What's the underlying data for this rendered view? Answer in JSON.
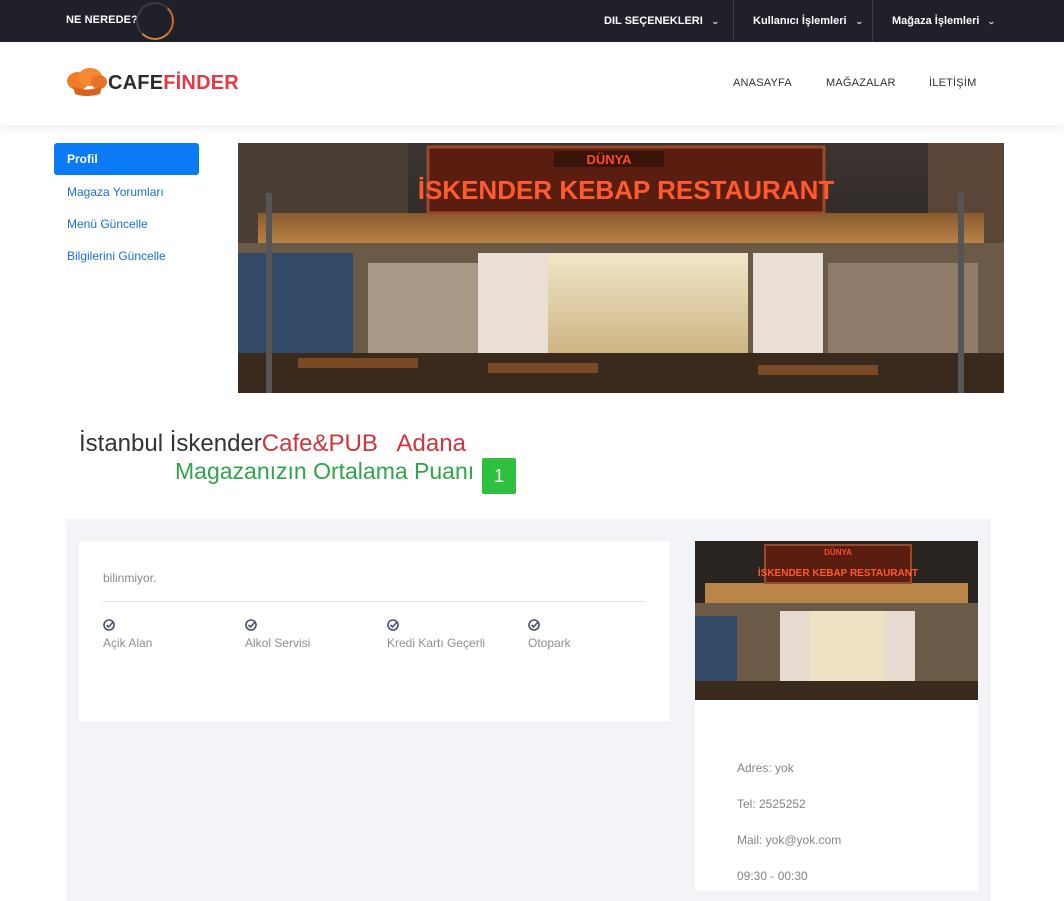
{
  "topbar": {
    "brand": "NE NEREDE?",
    "menus": [
      {
        "label": "DIL SEÇENEKLERI"
      },
      {
        "label": "Kullanıcı İşlemleri"
      },
      {
        "label": "Mağaza İşlemleri"
      }
    ],
    "chevron": "⌄"
  },
  "header": {
    "logo": {
      "part1": "CAFE",
      "part2": "FİNDER",
      "icon": "chef-hat-icon"
    },
    "nav": [
      {
        "label": "ANASAYFA"
      },
      {
        "label": "MAĞAZALAR"
      },
      {
        "label": "İLETİŞİM"
      }
    ]
  },
  "sidebar": {
    "items": [
      {
        "label": "Profil",
        "active": true
      },
      {
        "label": "Magaza Yorumları"
      },
      {
        "label": "Menü Güncelle"
      },
      {
        "label": "Bilgilerini Güncelle"
      }
    ]
  },
  "banner": {
    "sign_top": "DÜNYA",
    "sign_main": "İSKENDER KEBAP RESTAURANT"
  },
  "store": {
    "name": "İstanbul İskender",
    "type": "Cafe&PUB",
    "city": "Adana",
    "avg_label": "Magazanızın Ortalama Puanı",
    "avg_score": "1"
  },
  "details": {
    "description": "bilinmiyor.",
    "features": [
      {
        "label": "Açik Alan",
        "icon": "check-circle-icon"
      },
      {
        "label": "Alkol Servisi",
        "icon": "check-circle-icon"
      },
      {
        "label": "Kredi Kartı Geçerli",
        "icon": "check-circle-icon"
      },
      {
        "label": "Otopark",
        "icon": "check-circle-icon"
      }
    ]
  },
  "contact": {
    "address": "Adres: yok",
    "phone": "Tel: 2525252",
    "mail": "Mail: yok@yok.com",
    "hours": "09:30 - 00:30"
  },
  "colors": {
    "topbar_bg": "#1f2029",
    "accent_blue": "#0b7af5",
    "logo_red": "#e63946",
    "store_red": "#d2343c",
    "score_green": "#2ec03f",
    "panel_bg": "#f3f4f8"
  }
}
